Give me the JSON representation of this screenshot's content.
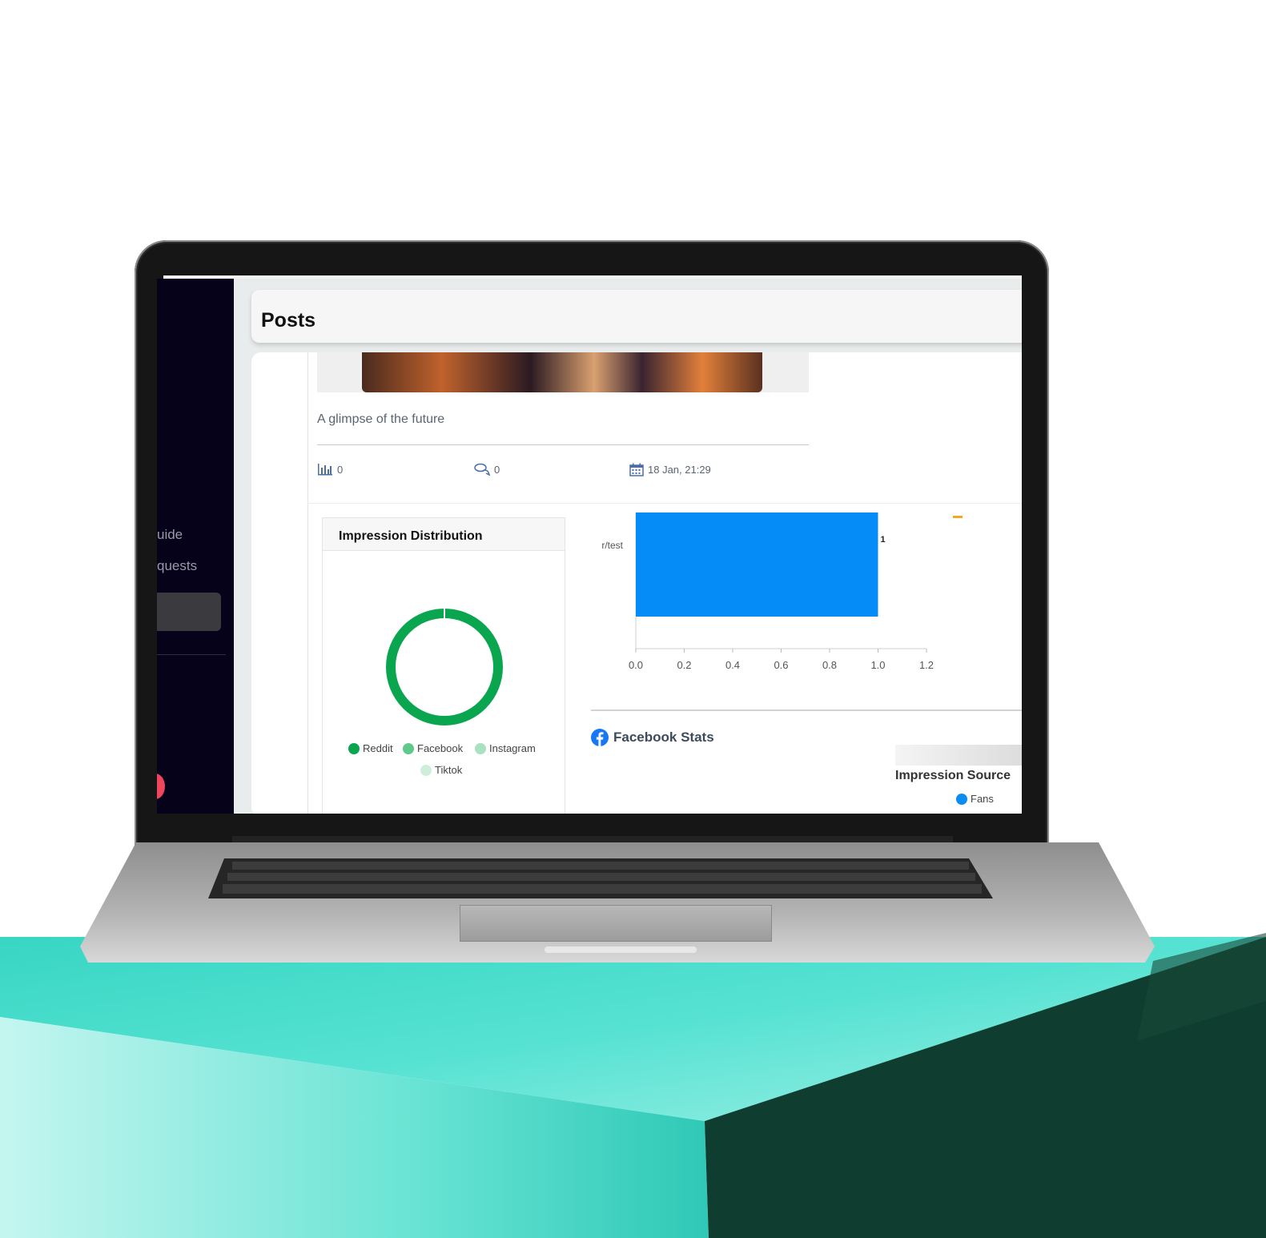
{
  "header": {
    "title": "Posts"
  },
  "sidebar": {
    "items": [
      {
        "label": "uide"
      },
      {
        "label": "quests"
      }
    ]
  },
  "post": {
    "caption": "A glimpse of the future",
    "views": "0",
    "comments": "0",
    "date": "18 Jan, 21:29"
  },
  "impression_distribution": {
    "title": "Impression Distribution",
    "legend": [
      {
        "label": "Reddit",
        "color": "#0aa64f"
      },
      {
        "label": "Facebook",
        "color": "#5fc98a"
      },
      {
        "label": "Instagram",
        "color": "#a8e2bf"
      },
      {
        "label": "Tiktok",
        "color": "#cdeedb"
      }
    ]
  },
  "chart_data": {
    "type": "bar",
    "orientation": "horizontal",
    "categories": [
      "r/test"
    ],
    "values": [
      1
    ],
    "data_labels": [
      "1"
    ],
    "xlim": [
      0,
      1.2
    ],
    "xticks": [
      "0.0",
      "0.2",
      "0.4",
      "0.6",
      "0.8",
      "1.0",
      "1.2"
    ],
    "bar_color": "#058cf7"
  },
  "facebook_stats": {
    "title": "Facebook Stats",
    "impression_source_title": "Impression Source",
    "legend": [
      {
        "label": "Fans",
        "color": "#0a8cf0"
      }
    ]
  },
  "colors": {
    "sidebar_bg": "#05021a",
    "accent_green": "#0aa64f",
    "desk_teal": "#3fd6c4",
    "desk_dark": "#0d3a2c"
  }
}
